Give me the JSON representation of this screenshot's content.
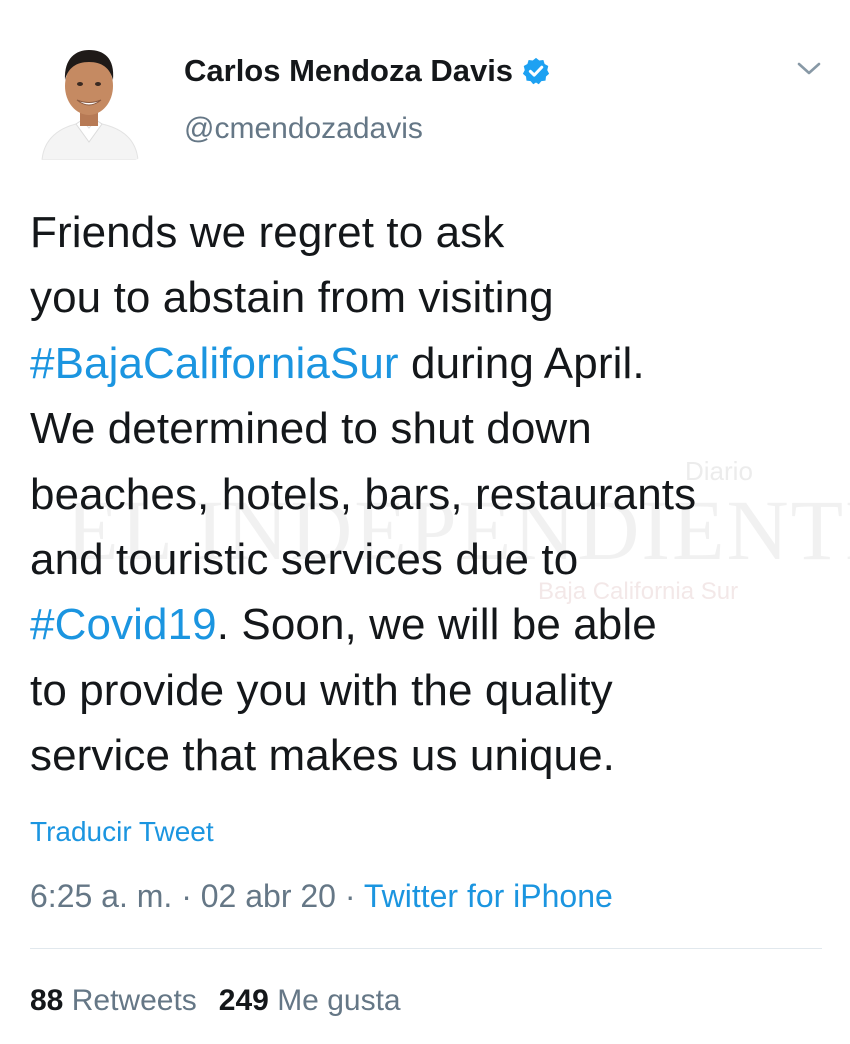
{
  "author": {
    "display_name": "Carlos Mendoza Davis",
    "handle": "@cmendozadavis",
    "verified": true,
    "avatar_icon": "profile-photo"
  },
  "tweet": {
    "lines": [
      {
        "text": "Friends we regret to ask"
      },
      {
        "text": "you to abstain from visiting"
      },
      {
        "hashtag": "#BajaCaliforniaSur",
        "text": " during April."
      },
      {
        "text": "We determined to shut down"
      },
      {
        "text": "beaches, hotels, bars, restaurants"
      },
      {
        "text": "and touristic services due to"
      },
      {
        "hashtag": "#Covid19",
        "text": ". Soon, we will be able"
      },
      {
        "text": "to provide you with the quality"
      },
      {
        "text": "service that makes us unique."
      }
    ]
  },
  "watermark": {
    "top": "Diario",
    "main": "EL INDEPENDIENTE",
    "bottom": "Baja California Sur"
  },
  "translate_label": "Traducir Tweet",
  "meta": {
    "time": "6:25 a. m.",
    "separator": " · ",
    "date": "02 abr 20",
    "source": "Twitter for iPhone"
  },
  "stats": {
    "retweets_count": "88",
    "retweets_label": "Retweets",
    "likes_count": "249",
    "likes_label": "Me gusta"
  },
  "colors": {
    "link": "#1b95e0",
    "secondary_text": "#657786",
    "primary_text": "#14171a",
    "verified": "#1da1f2"
  }
}
